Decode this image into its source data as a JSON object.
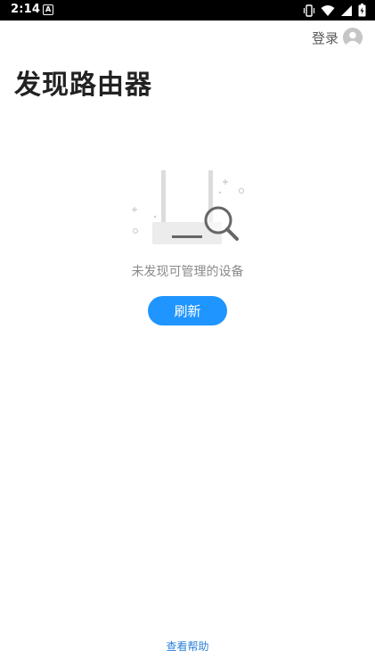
{
  "status_bar": {
    "time": "2:14",
    "notification_icon": "a-letter-icon",
    "right_icons": [
      "vibrate-icon",
      "wifi-icon",
      "signal-icon",
      "battery-icon"
    ]
  },
  "header": {
    "login_label": "登录",
    "avatar_icon": "avatar-icon"
  },
  "page": {
    "title": "发现路由器"
  },
  "empty_state": {
    "illustration_icon": "router-search-illustration",
    "message": "未发现可管理的设备",
    "refresh_label": "刷新"
  },
  "footer": {
    "help_label": "查看帮助"
  },
  "colors": {
    "accent": "#1f95ff",
    "link": "#2c7fd9",
    "title": "#222222",
    "muted": "#8a8a8a"
  }
}
